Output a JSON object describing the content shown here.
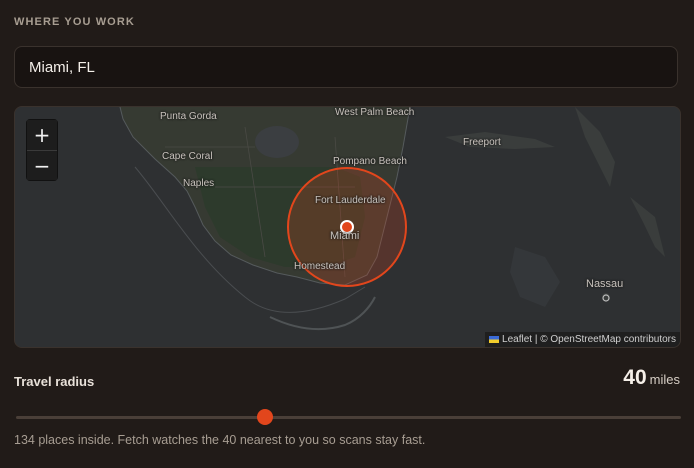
{
  "section": {
    "label": "WHERE YOU WORK"
  },
  "location": {
    "value": "Miami, FL"
  },
  "map": {
    "zoom_in_label": "+",
    "zoom_out_label": "−",
    "attribution": {
      "leaflet": "Leaflet",
      "separator": " | ",
      "osm": "© OpenStreetMap contributors"
    },
    "places": {
      "punta_gorda": "Punta Gorda",
      "cape_coral": "Cape Coral",
      "naples": "Naples",
      "west_palm_beach": "West Palm Beach",
      "pompano_beach": "Pompano Beach",
      "fort_lauderdale": "Fort Lauderdale",
      "miami": "Miami",
      "homestead": "Homestead",
      "freeport": "Freeport",
      "nassau": "Nassau"
    },
    "accent_color": "#e2461c"
  },
  "radius": {
    "label": "Travel radius",
    "value": "40",
    "unit": "miles",
    "fraction": 0.375
  },
  "help": {
    "text": "134 places inside. Fetch watches the 40 nearest to you so scans stay fast."
  }
}
